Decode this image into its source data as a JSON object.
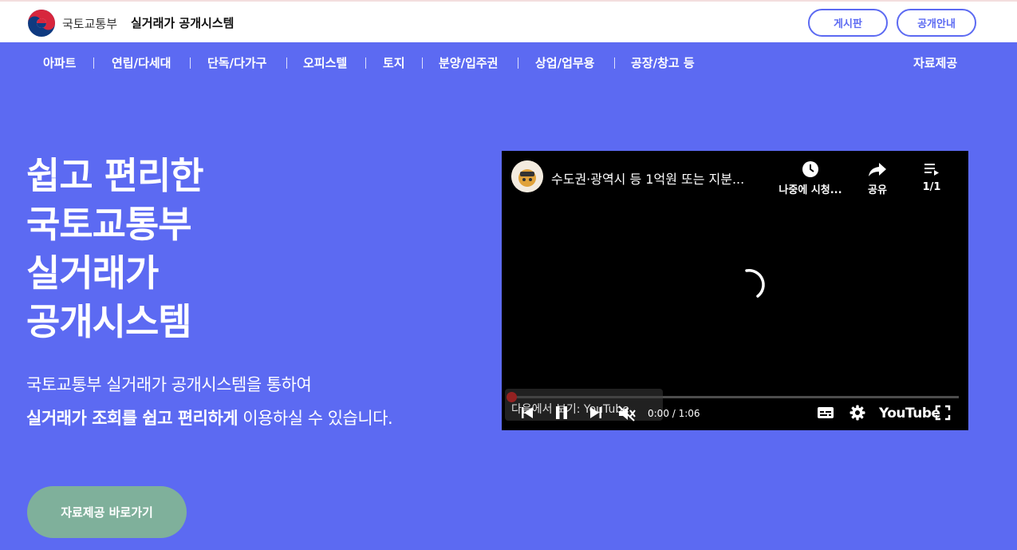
{
  "header": {
    "ministry": "국토교통부",
    "system_title": "실거래가 공개시스템",
    "board_label": "게시판",
    "guide_label": "공개안내"
  },
  "nav": {
    "items": [
      "아파트",
      "연립/다세대",
      "단독/다가구",
      "오피스텔",
      "토지",
      "분양/입주권",
      "상업/업무용",
      "공장/창고 등"
    ],
    "data_label": "자료제공"
  },
  "hero": {
    "title_lines": [
      "쉽고 편리한",
      "국토교통부",
      "실거래가",
      "공개시스템"
    ],
    "desc_line1": "국토교통부 실거래가 공개시스템을 통하여",
    "desc_bold": "실거래가 조회를 쉽고 편리하게",
    "desc_rest": " 이용하실 수 있습니다.",
    "cta_label": "자료제공 바로가기"
  },
  "video": {
    "title": "수도권·광역시 등 1억원 또는 지분...",
    "watch_later": "나중에 시청...",
    "share": "공유",
    "playlist_count": "1/1",
    "watch_on": "다음에서 보기:",
    "watch_on_brand": "YouTube",
    "time": "0:00 / 1:06",
    "youtube_label": "YouTube",
    "progress": 0
  },
  "colors": {
    "brand": "#5c6af2",
    "cta": "#7fb09b"
  }
}
